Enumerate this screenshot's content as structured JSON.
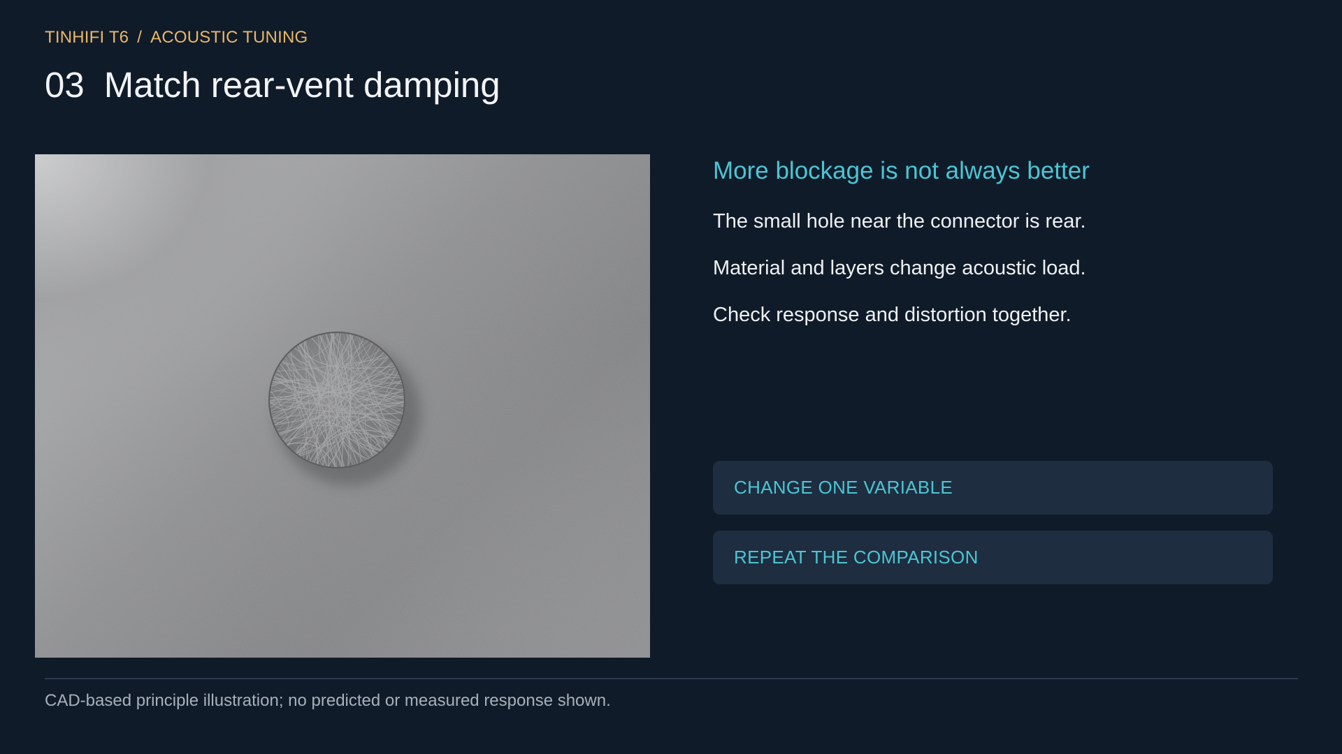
{
  "breadcrumb": {
    "product": "TINHIFI T6",
    "separator": "/",
    "section": "ACOUSTIC TUNING"
  },
  "slide": {
    "number": "03",
    "title": "Match rear-vent damping"
  },
  "image": {
    "subject": "round fibrous damping disc on grey surface"
  },
  "content": {
    "heading": "More blockage is not always better",
    "points": [
      "The small hole near the connector is rear.",
      "Material and layers change acoustic load.",
      "Check response and distortion together."
    ]
  },
  "actions": [
    {
      "label": "CHANGE ONE VARIABLE"
    },
    {
      "label": "REPEAT THE COMPARISON"
    }
  ],
  "footer": {
    "note": "CAD-based principle illustration; no predicted or measured response shown."
  },
  "colors": {
    "background": "#101b29",
    "accent_cyan": "#4cc5d3",
    "accent_orange": "#e8b76b",
    "card": "#1e2d40"
  }
}
